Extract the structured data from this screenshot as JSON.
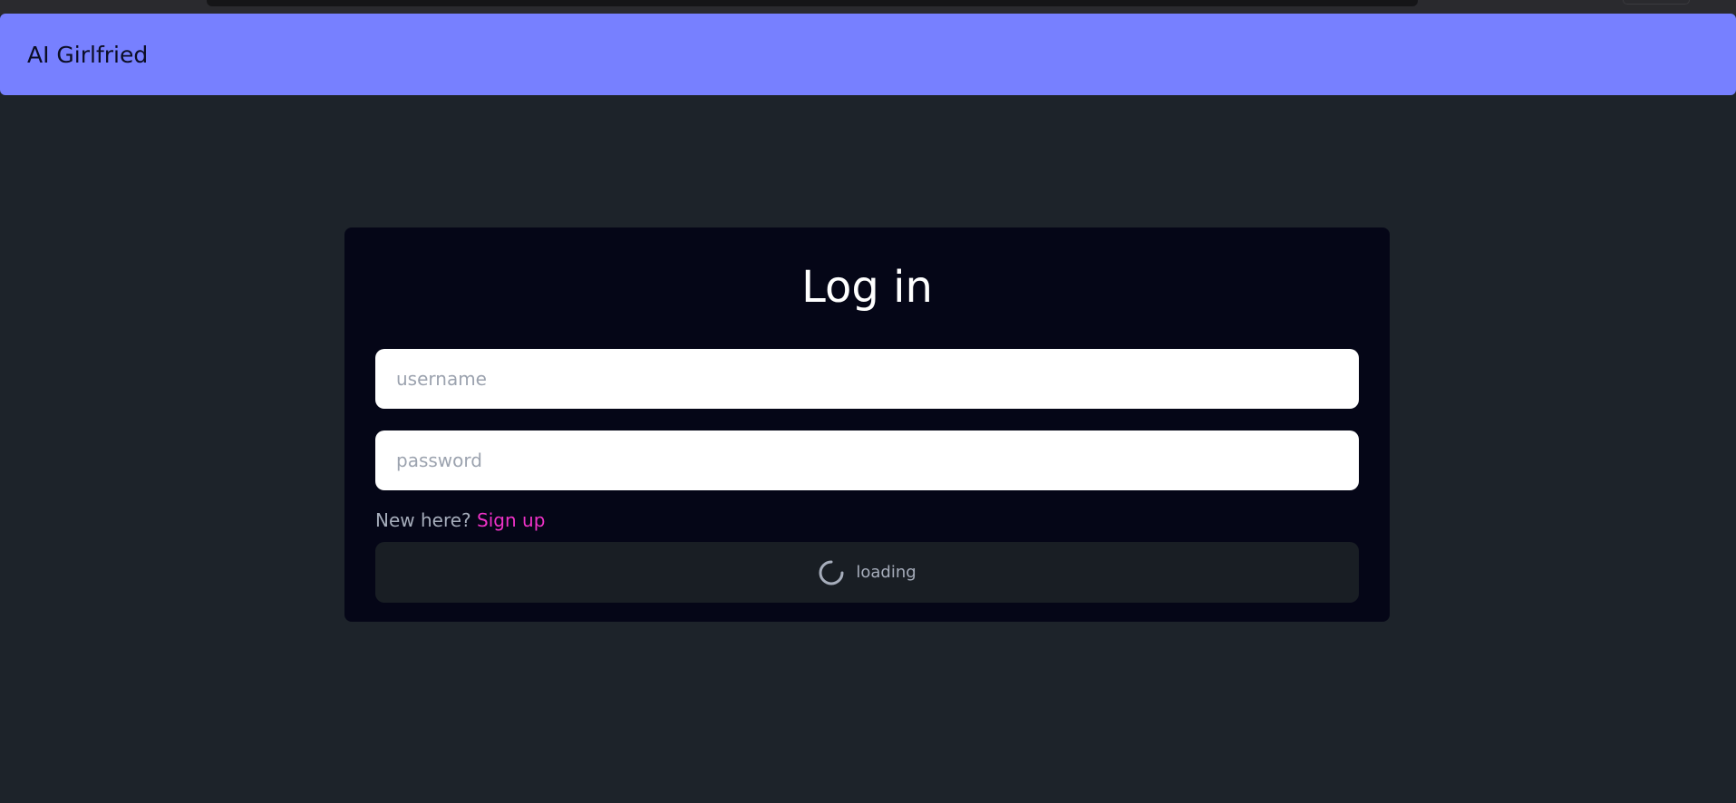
{
  "app": {
    "brand": "AI Girlfried"
  },
  "login": {
    "title": "Log in",
    "username_placeholder": "username",
    "password_placeholder": "password",
    "signup_prompt": "New here?",
    "signup_link": "Sign up",
    "submit_label": "loading"
  },
  "icons": {
    "spinner": "loading-spinner-icon"
  },
  "colors": {
    "navbar": "#7780ff",
    "background": "#1d232a",
    "card": "#050617",
    "link": "#f032c8",
    "button": "#191e24"
  }
}
